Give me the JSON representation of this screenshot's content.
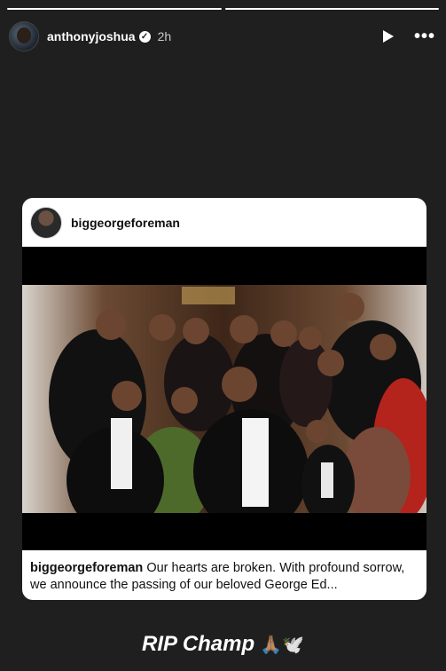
{
  "story": {
    "username": "anthonyjoshua",
    "verified_mark": "✓",
    "time": "2h",
    "progress": [
      1,
      1
    ],
    "icons": [
      "play-icon",
      "more-icon",
      "verified-icon"
    ]
  },
  "post": {
    "username": "biggeorgeforeman",
    "caption_user": "biggeorgeforeman",
    "caption_text": " Our hearts are broken. With profound sorrow, we announce the passing of our beloved George Ed..."
  },
  "sticker": {
    "text": "RIP Champ",
    "emoji": "🙏🏽🕊️"
  },
  "colors": {
    "background": "#1f1f1f",
    "card": "#ffffff",
    "text_dark": "#111111"
  }
}
